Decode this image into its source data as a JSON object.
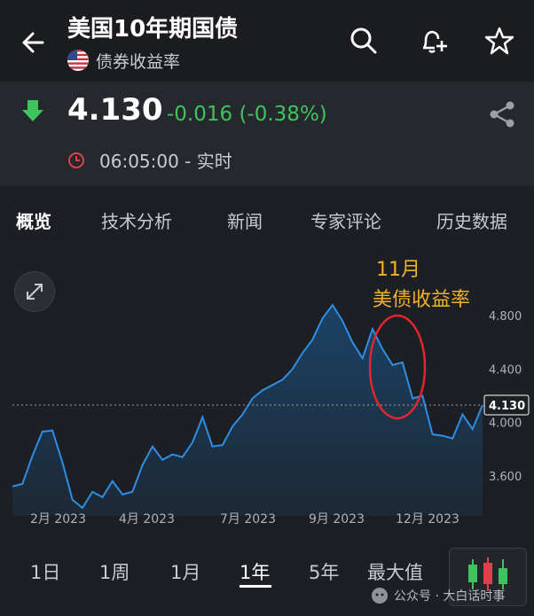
{
  "header": {
    "title": "美国10年期国债",
    "subtitle": "债券收益率",
    "icons": [
      "back-arrow-icon",
      "search-icon",
      "add-alert-icon",
      "star-icon"
    ]
  },
  "quote": {
    "price": "4.130",
    "change": "-0.016 (-0.38%)",
    "time": "06:05:00 - 实时",
    "colors": {
      "down": "#3fc45d",
      "clock": "#e0404a"
    }
  },
  "tabs": [
    "概览",
    "技术分析",
    "新闻",
    "专家评论",
    "历史数据"
  ],
  "annotation": {
    "line1": "11月",
    "line2": "美债收益率",
    "color": "#f2b227"
  },
  "ranges": {
    "items": [
      "1日",
      "1周",
      "1月",
      "1年",
      "5年",
      "最大值"
    ],
    "selected": "1年"
  },
  "watermark": {
    "text": "公众号 · 大白话时事"
  },
  "chart_data": {
    "type": "area",
    "xlabels": [
      "2月 2023",
      "4月 2023",
      "7月 2023",
      "9月 2023",
      "12月 2023"
    ],
    "yticks": [
      "4.800",
      "4.400",
      "4.000",
      "3.600"
    ],
    "current_label": "4.130",
    "current_value": 4.13,
    "ylim": [
      3.3,
      5.0
    ],
    "x": [
      0,
      4,
      8,
      12,
      15,
      18,
      21,
      24,
      27,
      31,
      35,
      39,
      43,
      46,
      50,
      54,
      57,
      61,
      65,
      69,
      73,
      76,
      80,
      84,
      88,
      92,
      95,
      99,
      103,
      107,
      111,
      115,
      118,
      122,
      126,
      130
    ],
    "values": [
      3.52,
      3.54,
      3.75,
      3.93,
      3.94,
      3.7,
      3.42,
      3.36,
      3.48,
      3.44,
      3.56,
      3.46,
      3.48,
      3.68,
      3.82,
      3.72,
      3.76,
      3.74,
      3.85,
      4.04,
      3.82,
      3.83,
      3.97,
      4.06,
      4.18,
      4.24,
      4.28,
      4.32,
      4.4,
      4.52,
      4.62,
      4.78,
      4.88,
      4.76,
      4.6,
      4.48,
      4.7,
      4.55,
      4.43,
      4.45,
      4.18,
      4.2,
      3.91,
      3.9,
      3.88,
      4.06,
      3.95,
      4.13
    ],
    "line_color": "#2e8ee5",
    "fill_color": "#1c4468",
    "grid": false
  }
}
